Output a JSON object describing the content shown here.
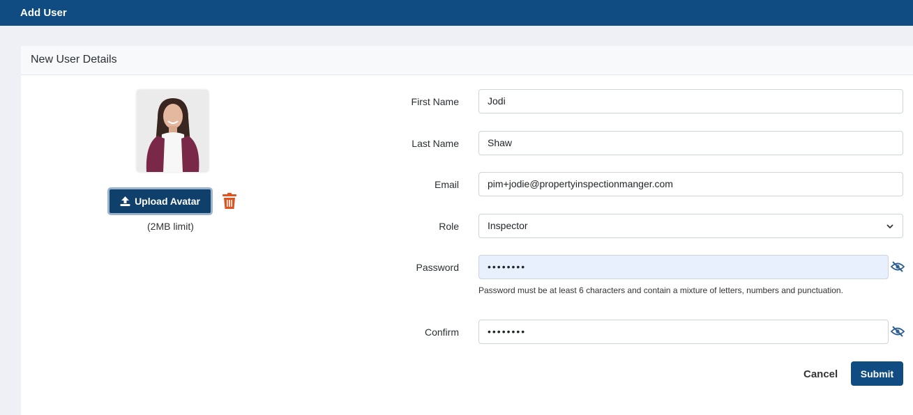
{
  "app": {
    "title": "Add User"
  },
  "card": {
    "header": "New User Details"
  },
  "avatar": {
    "upload_label": "Upload Avatar",
    "limit_text": "(2MB limit)"
  },
  "form": {
    "first_name": {
      "label": "First Name",
      "value": "Jodi"
    },
    "last_name": {
      "label": "Last Name",
      "value": "Shaw"
    },
    "email": {
      "label": "Email",
      "value": "pim+jodie@propertyinspectionmanger.com"
    },
    "role": {
      "label": "Role",
      "value": "Inspector"
    },
    "password": {
      "label": "Password",
      "value": "••••••••",
      "hint": "Password must be at least 6 characters and contain a mixture of letters, numbers and punctuation."
    },
    "confirm": {
      "label": "Confirm",
      "value": "••••••••"
    }
  },
  "actions": {
    "cancel_label": "Cancel",
    "submit_label": "Submit"
  },
  "colors": {
    "brand": "#104c82",
    "danger": "#e0531f",
    "autofill": "#e8f0fe"
  },
  "icons": {
    "upload": "upload-icon",
    "trash": "trash-icon",
    "chevron": "chevron-down-icon",
    "eye": "eye-slash-icon"
  }
}
